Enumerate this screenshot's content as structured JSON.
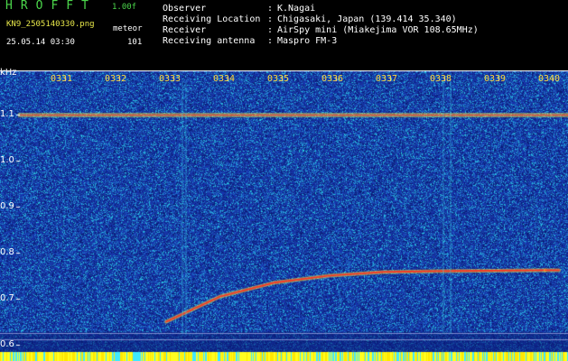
{
  "header": {
    "app_name": "HROFFT",
    "version": "1.00f",
    "filename": "KN9_2505140330.png",
    "mode": "meteor",
    "datetime": "25.05.14 03:30",
    "count": "101",
    "info": [
      {
        "key": "Observer",
        "value": "K.Nagai"
      },
      {
        "key": "Receiving Location",
        "value": "Chigasaki, Japan (139.414 35.340)"
      },
      {
        "key": "Receiver",
        "value": "AirSpy mini (Miakejima VOR 108.65MHz)"
      },
      {
        "key": "Receiving antenna",
        "value": "Maspro FM-3"
      }
    ]
  },
  "spectrogram": {
    "unit": "kHz",
    "y_labels": [
      "1.1",
      "1.0",
      "0.9",
      "0.8",
      "0.7",
      "0.6"
    ],
    "time_labels": [
      "0331",
      "0332",
      "0333",
      "0334",
      "0335",
      "0336",
      "0337",
      "0338",
      "0339",
      "0340"
    ],
    "signals": {
      "carrier_khz": 1.1,
      "meteor_trail": [
        {
          "t": "0333",
          "khz": 0.65
        },
        {
          "t": "0334",
          "khz": 0.705
        },
        {
          "t": "0335",
          "khz": 0.735
        },
        {
          "t": "0336",
          "khz": 0.75
        },
        {
          "t": "0337",
          "khz": 0.758
        },
        {
          "t": "0338",
          "khz": 0.76
        },
        {
          "t": "0340",
          "khz": 0.762
        }
      ]
    }
  }
}
